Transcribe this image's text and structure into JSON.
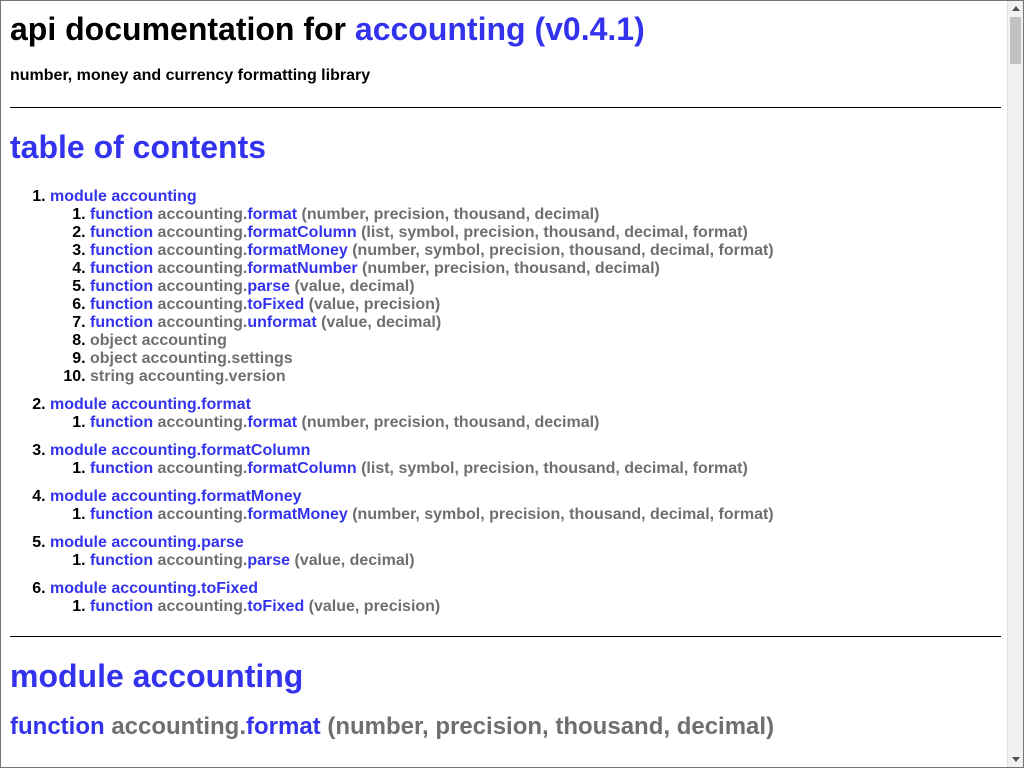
{
  "header": {
    "title_prefix": "api documentation for",
    "title_link": "accounting (v0.4.1)",
    "subtitle": "number, money and currency formatting library"
  },
  "toc": {
    "title": "table of contents",
    "modules": [
      {
        "label": "module accounting",
        "items": [
          {
            "kind": "function",
            "owner": "accounting.",
            "name": "format",
            "args": " (number, precision, thousand, decimal)"
          },
          {
            "kind": "function",
            "owner": "accounting.",
            "name": "formatColumn",
            "args": " (list, symbol, precision, thousand, decimal, format)"
          },
          {
            "kind": "function",
            "owner": "accounting.",
            "name": "formatMoney",
            "args": " (number, symbol, precision, thousand, decimal, format)"
          },
          {
            "kind": "function",
            "owner": "accounting.",
            "name": "formatNumber",
            "args": " (number, precision, thousand, decimal)"
          },
          {
            "kind": "function",
            "owner": "accounting.",
            "name": "parse",
            "args": " (value, decimal)"
          },
          {
            "kind": "function",
            "owner": "accounting.",
            "name": "toFixed",
            "args": " (value, precision)"
          },
          {
            "kind": "function",
            "owner": "accounting.",
            "name": "unformat",
            "args": " (value, decimal)"
          },
          {
            "plain": "object accounting"
          },
          {
            "plain": "object accounting.settings"
          },
          {
            "plain": "string accounting.version"
          }
        ]
      },
      {
        "label": "module accounting.format",
        "items": [
          {
            "kind": "function",
            "owner": "accounting.",
            "name": "format",
            "args": " (number, precision, thousand, decimal)"
          }
        ]
      },
      {
        "label": "module accounting.formatColumn",
        "items": [
          {
            "kind": "function",
            "owner": "accounting.",
            "name": "formatColumn",
            "args": " (list, symbol, precision, thousand, decimal, format)"
          }
        ]
      },
      {
        "label": "module accounting.formatMoney",
        "items": [
          {
            "kind": "function",
            "owner": "accounting.",
            "name": "formatMoney",
            "args": " (number, symbol, precision, thousand, decimal, format)"
          }
        ]
      },
      {
        "label": "module accounting.parse",
        "items": [
          {
            "kind": "function",
            "owner": "accounting.",
            "name": "parse",
            "args": " (value, decimal)"
          }
        ]
      },
      {
        "label": "module accounting.toFixed",
        "items": [
          {
            "kind": "function",
            "owner": "accounting.",
            "name": "toFixed",
            "args": " (value, precision)"
          }
        ]
      }
    ]
  },
  "section": {
    "module_title": "module accounting",
    "function_heading": {
      "kind": "function",
      "owner": "accounting.",
      "name": "format",
      "args": " (number, precision, thousand, decimal)"
    }
  },
  "colors": {
    "link": "#3333ee",
    "muted": "#6f6f6f",
    "text": "#000000"
  }
}
